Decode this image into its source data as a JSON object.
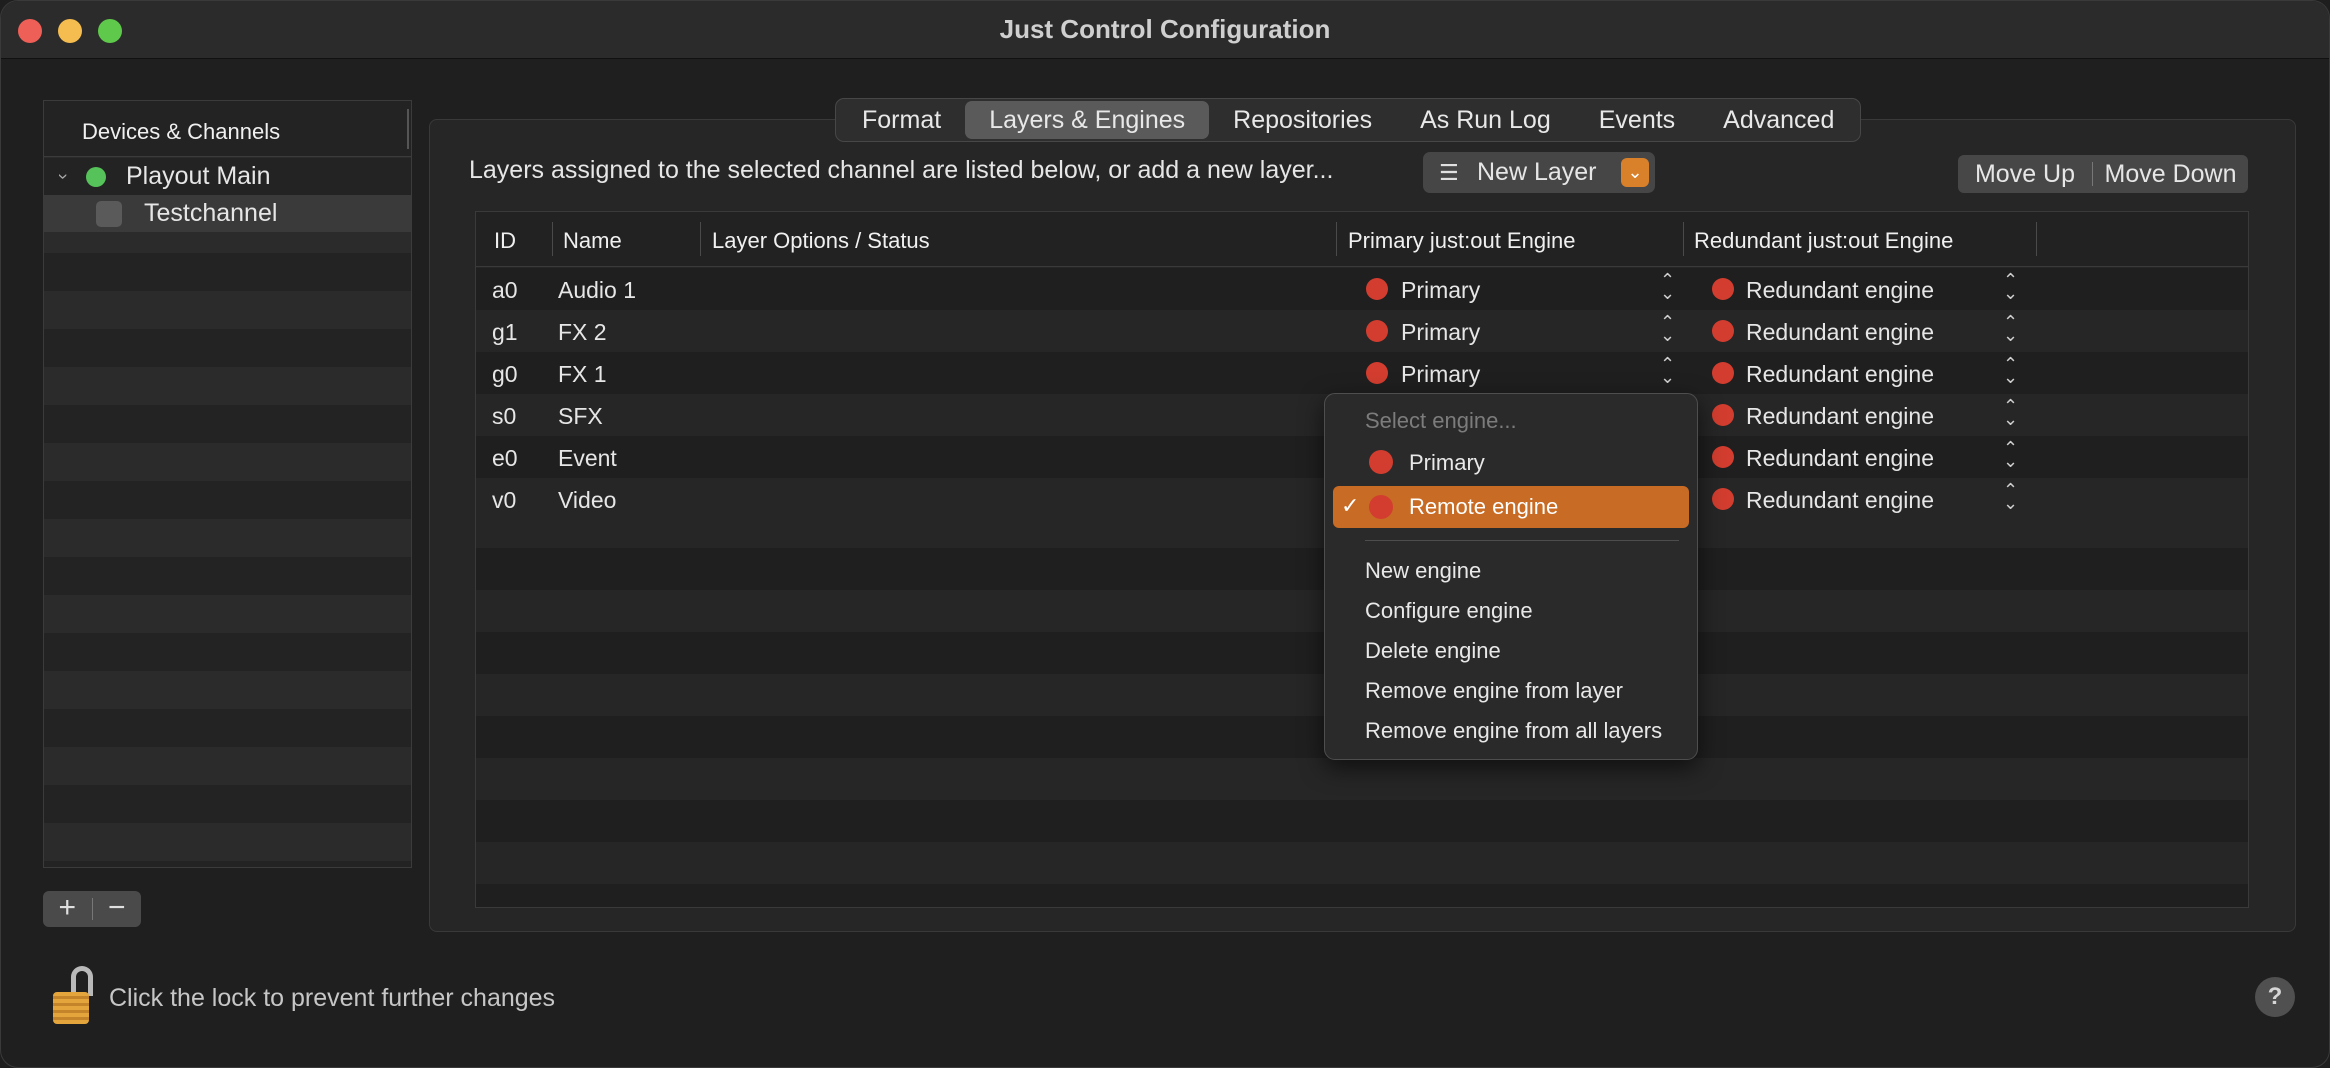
{
  "window": {
    "title": "Just Control Configuration"
  },
  "sidebar": {
    "header": "Devices & Channels",
    "items": [
      {
        "label": "Playout Main",
        "status": "green"
      },
      {
        "label": "Testchannel"
      }
    ],
    "add_label": "+",
    "remove_label": "−"
  },
  "tabs": [
    {
      "label": "Format"
    },
    {
      "label": "Layers & Engines",
      "active": true
    },
    {
      "label": "Repositories"
    },
    {
      "label": "As Run Log"
    },
    {
      "label": "Events"
    },
    {
      "label": "Advanced"
    }
  ],
  "toolbar": {
    "intro_text": "Layers assigned to the selected channel are listed below, or add a new layer...",
    "new_layer_label": "New Layer",
    "move_up_label": "Move Up",
    "move_down_label": "Move Down"
  },
  "table": {
    "columns": [
      "ID",
      "Name",
      "Layer Options / Status",
      "Primary just:out Engine",
      "Redundant just:out Engine"
    ],
    "rows": [
      {
        "id": "a0",
        "name": "Audio 1",
        "primary": "Primary",
        "redundant": "Redundant engine"
      },
      {
        "id": "g1",
        "name": "FX 2",
        "primary": "Primary",
        "redundant": "Redundant engine"
      },
      {
        "id": "g0",
        "name": "FX 1",
        "primary": "Primary",
        "redundant": "Redundant engine"
      },
      {
        "id": "s0",
        "name": "SFX",
        "primary": "",
        "redundant": "Redundant engine"
      },
      {
        "id": "e0",
        "name": "Event",
        "primary": "",
        "redundant": "Redundant engine"
      },
      {
        "id": "v0",
        "name": "Video",
        "primary": "",
        "redundant": "Redundant engine"
      }
    ]
  },
  "engine_menu": {
    "placeholder": "Select engine...",
    "engines": [
      {
        "label": "Primary"
      },
      {
        "label": "Remote engine",
        "selected": true
      }
    ],
    "actions": [
      "New engine",
      "Configure engine",
      "Delete engine",
      "Remove engine from layer",
      "Remove engine from all layers"
    ]
  },
  "footer": {
    "lock_text": "Click the lock to prevent further changes",
    "help_label": "?"
  },
  "colors": {
    "accent": "#c86b24",
    "status_red": "#d23d2f",
    "status_green": "#55c25a"
  }
}
